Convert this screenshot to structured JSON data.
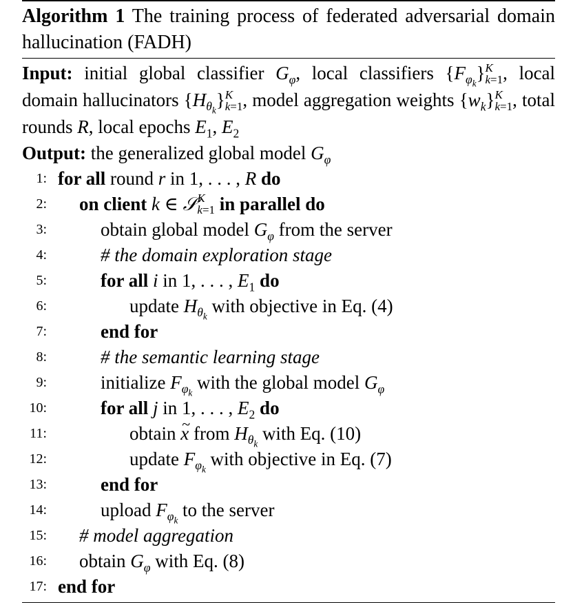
{
  "algorithm": {
    "label": "Algorithm 1",
    "caption": "The training process of federated adversarial domain hallucination (FADH)"
  },
  "io": {
    "input_label": "Input:",
    "input_text_1": "initial global classifier",
    "input_text_2": "local classifiers",
    "input_text_3": "local domain hallucinators",
    "input_text_4": "model aggregation weights",
    "input_text_5": "total rounds",
    "input_text_6": "local epochs",
    "output_label": "Output:",
    "output_text": "the generalized global model"
  },
  "lines": [
    {
      "n": "1:",
      "kw1": "for all",
      "text": "round",
      "kw2": "do"
    },
    {
      "n": "2:",
      "kw1": "on client",
      "kw2": "in parallel do"
    },
    {
      "n": "3:",
      "text": "obtain global model",
      "text2": "from the server"
    },
    {
      "n": "4:",
      "comment": "# the domain exploration stage"
    },
    {
      "n": "5:",
      "kw1": "for all",
      "text": "in",
      "kw2": "do"
    },
    {
      "n": "6:",
      "text": "update",
      "text2": "with objective in Eq. (4)"
    },
    {
      "n": "7:",
      "kw1": "end for"
    },
    {
      "n": "8:",
      "comment": "# the semantic learning stage"
    },
    {
      "n": "9:",
      "text": "initialize",
      "text2": "with the global model"
    },
    {
      "n": "10:",
      "kw1": "for all",
      "text": "in",
      "kw2": "do"
    },
    {
      "n": "11:",
      "text": "obtain",
      "text2": "from",
      "text3": "with Eq. (10)"
    },
    {
      "n": "12:",
      "text": "update",
      "text2": "with objective in Eq. (7)"
    },
    {
      "n": "13:",
      "kw1": "end for"
    },
    {
      "n": "14:",
      "text": "upload",
      "text2": "to the server"
    },
    {
      "n": "15:",
      "comment": "# model aggregation"
    },
    {
      "n": "16:",
      "text": "obtain",
      "text2": "with Eq. (8)"
    },
    {
      "n": "17:",
      "kw1": "end for"
    }
  ]
}
